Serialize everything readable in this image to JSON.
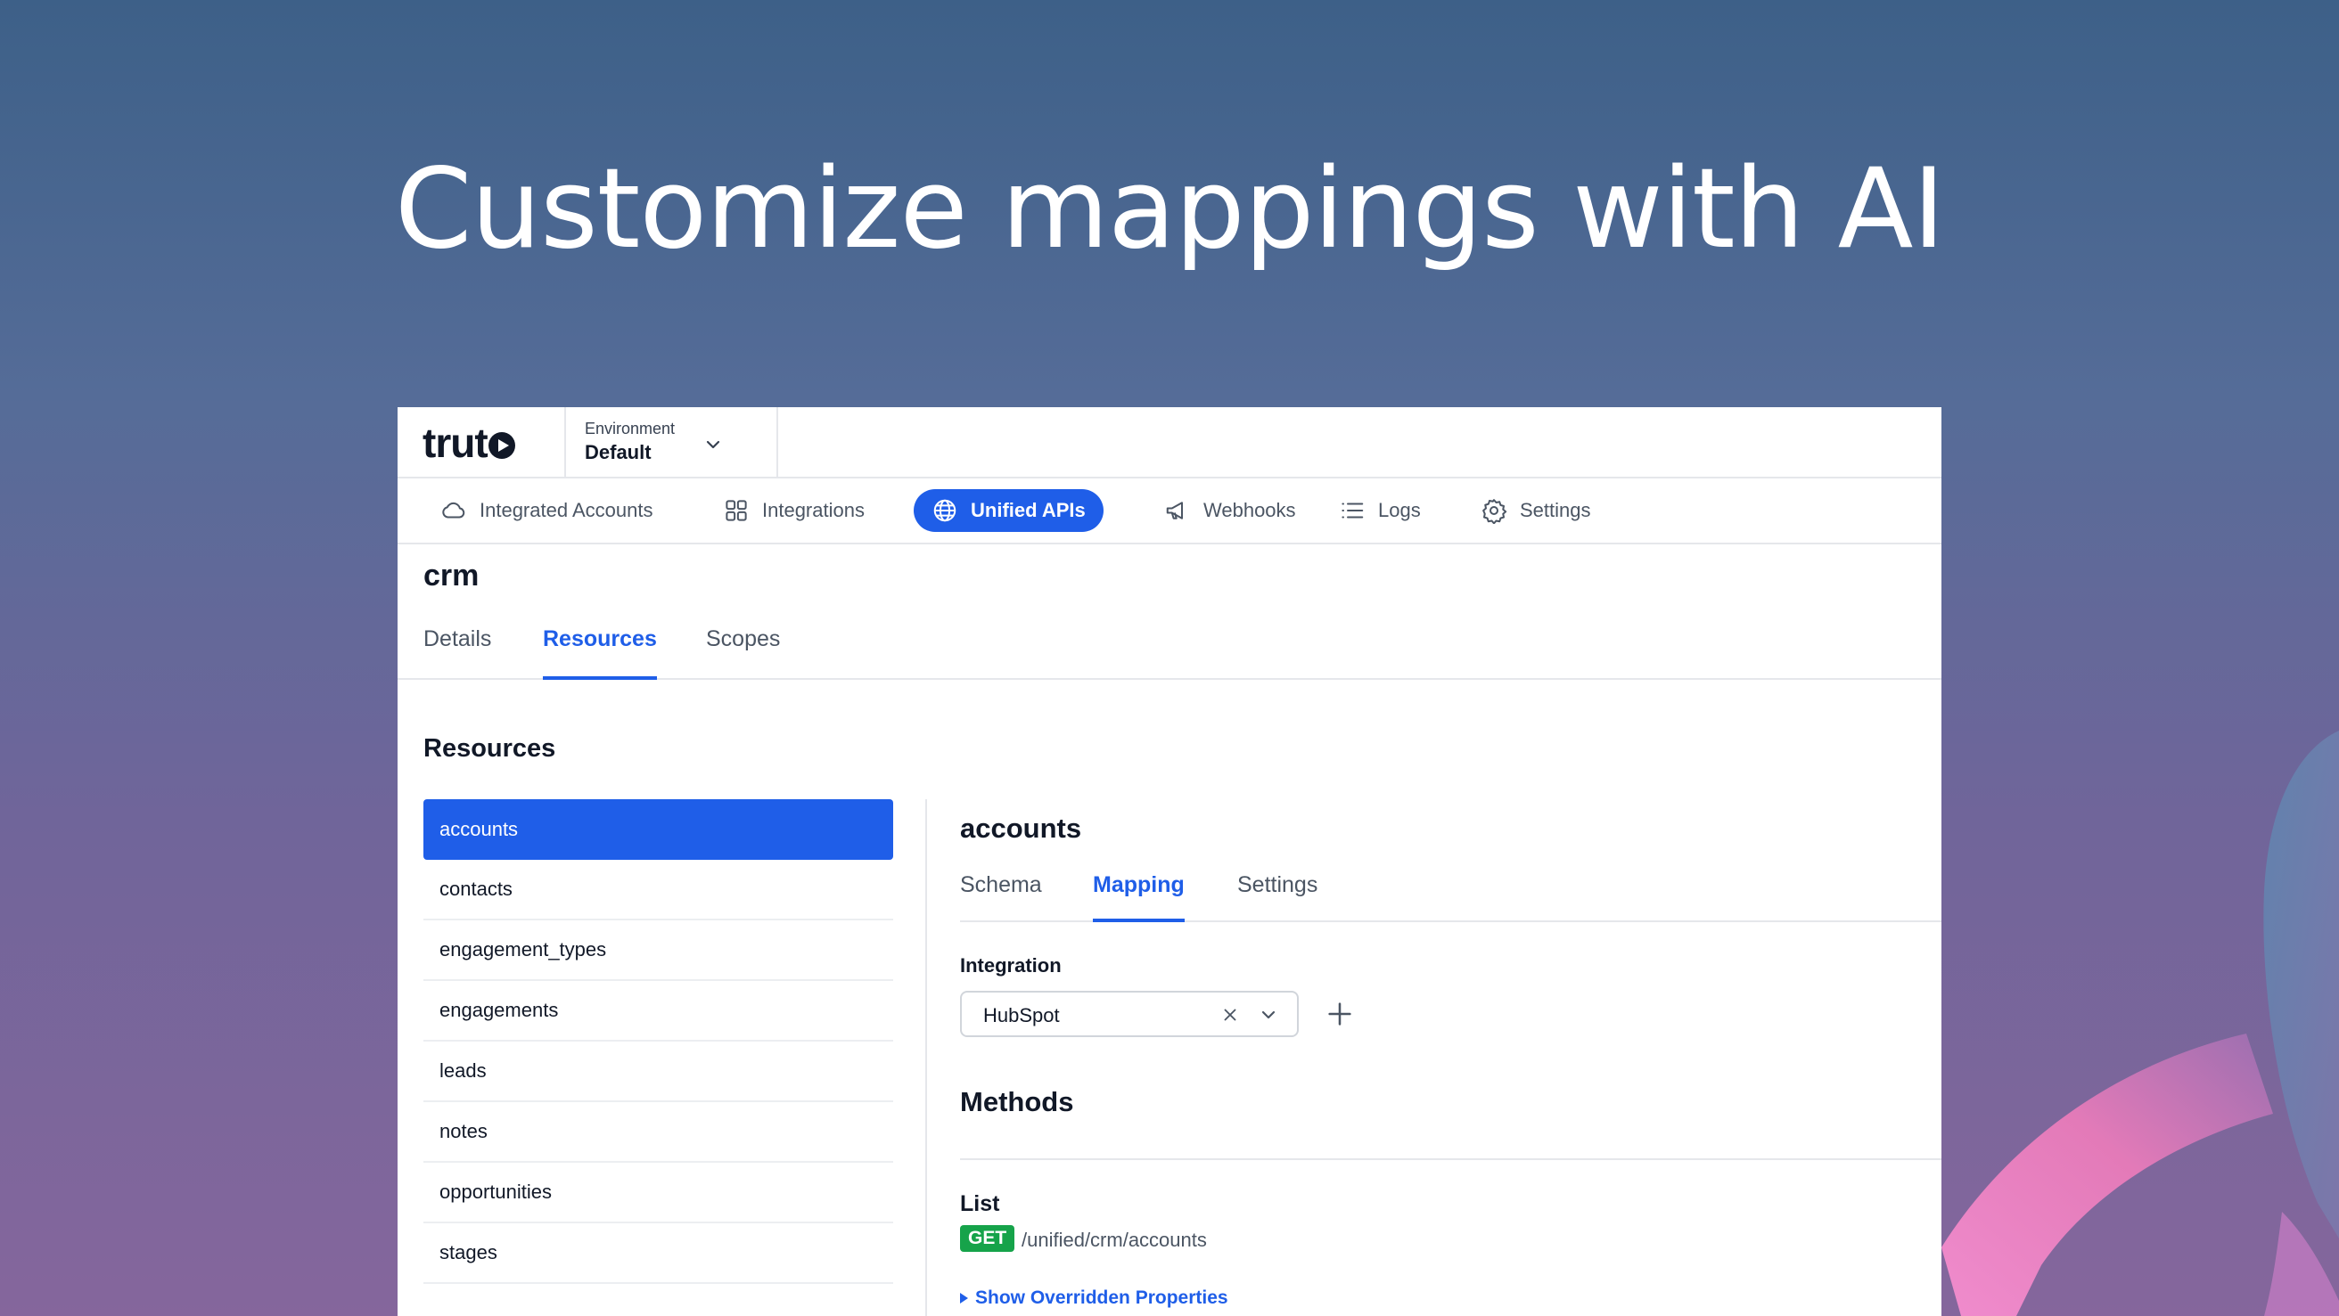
{
  "headline": "Customize mappings with AI",
  "brand": {
    "logo_text": "trut"
  },
  "environment": {
    "label": "Environment",
    "value": "Default"
  },
  "nav": {
    "items": [
      {
        "label": "Integrated Accounts",
        "icon": "cloud-icon"
      },
      {
        "label": "Integrations",
        "icon": "grid-icon"
      },
      {
        "label": "Unified APIs",
        "icon": "globe-icon",
        "active": true
      },
      {
        "label": "Webhooks",
        "icon": "megaphone-icon"
      },
      {
        "label": "Logs",
        "icon": "list-icon"
      },
      {
        "label": "Settings",
        "icon": "gear-icon"
      }
    ]
  },
  "page": {
    "title": "crm",
    "tabs": [
      {
        "label": "Details"
      },
      {
        "label": "Resources",
        "active": true
      },
      {
        "label": "Scopes"
      }
    ],
    "section_title": "Resources"
  },
  "resources": {
    "items": [
      "accounts",
      "contacts",
      "engagement_types",
      "engagements",
      "leads",
      "notes",
      "opportunities",
      "stages"
    ],
    "selected": "accounts"
  },
  "detail": {
    "title": "accounts",
    "tabs": [
      {
        "label": "Schema"
      },
      {
        "label": "Mapping",
        "active": true
      },
      {
        "label": "Settings"
      }
    ],
    "integration_label": "Integration",
    "integration_value": "HubSpot",
    "methods_title": "Methods",
    "method": {
      "name": "List",
      "verb": "GET",
      "path": "/unified/crm/accounts",
      "toggle_label": "Show Overridden Properties"
    }
  },
  "colors": {
    "accent": "#1f5ee8",
    "get_badge": "#16a34a",
    "background_top": "#3d6088",
    "background_bottom": "#85669c"
  }
}
